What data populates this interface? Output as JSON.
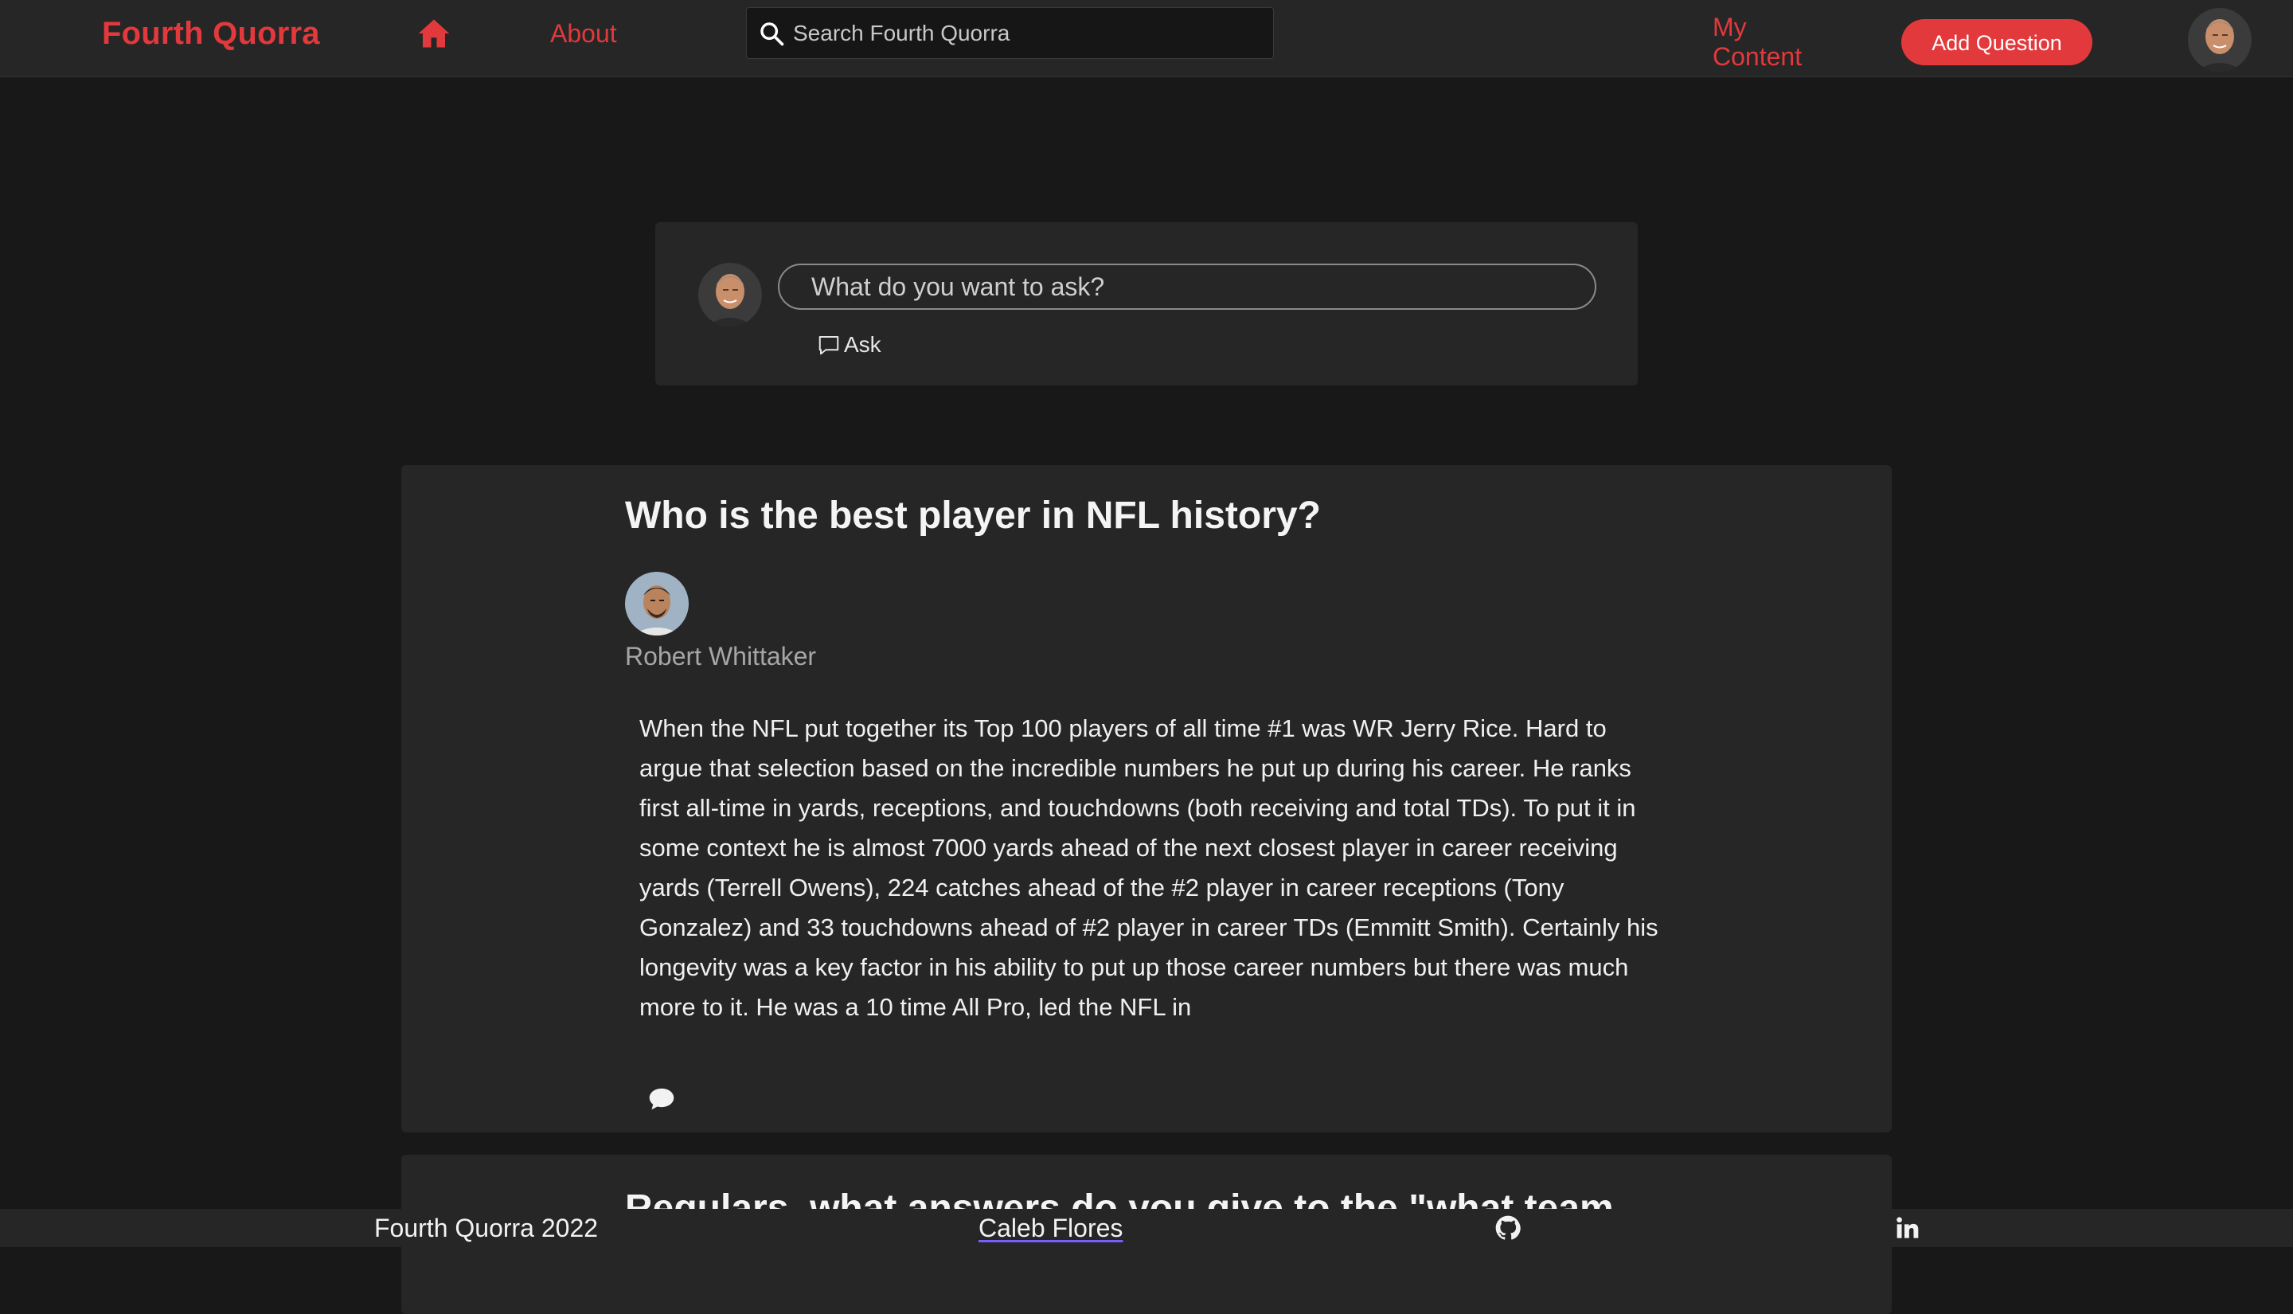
{
  "header": {
    "logo": "Fourth Quorra",
    "home_icon": "home-icon",
    "about_label": "About",
    "search_placeholder": "Search Fourth Quorra",
    "my_content_label": "My Content",
    "add_question_label": "Add Question",
    "user_avatar": "avatar"
  },
  "ask": {
    "placeholder": "What do you want to ask?",
    "ask_label": "Ask"
  },
  "feed": {
    "questions": [
      {
        "title": "Who is the best player in NFL history?",
        "author": "Robert Whittaker",
        "answer": "When the NFL put together its Top 100 players of all time #1 was WR Jerry Rice. Hard to argue that selection based on the incredible numbers he put up during his career. He ranks first all-time in yards, receptions, and touchdowns (both receiving and total TDs). To put it in some context he is almost 7000 yards ahead of the next closest player in career receiving yards (Terrell Owens), 224 catches ahead of the #2 player in career receptions (Tony Gonzalez) and 33 touchdowns ahead of #2 player in career TDs (Emmitt Smith). Certainly his longevity was a key factor in his ability to put up those career numbers but there was much more to it. He was a 10 time All Pro, led the NFL in"
      },
      {
        "title": "Regulars, what answers do you give to the \"what team"
      }
    ]
  },
  "footer": {
    "copyright": "Fourth Quorra 2022",
    "author_link": "Caleb Flores",
    "github_icon": "github-icon",
    "linkedin_icon": "linkedin-icon"
  },
  "colors": {
    "accent": "#e2393c",
    "background": "#181818",
    "surface": "#262626"
  }
}
